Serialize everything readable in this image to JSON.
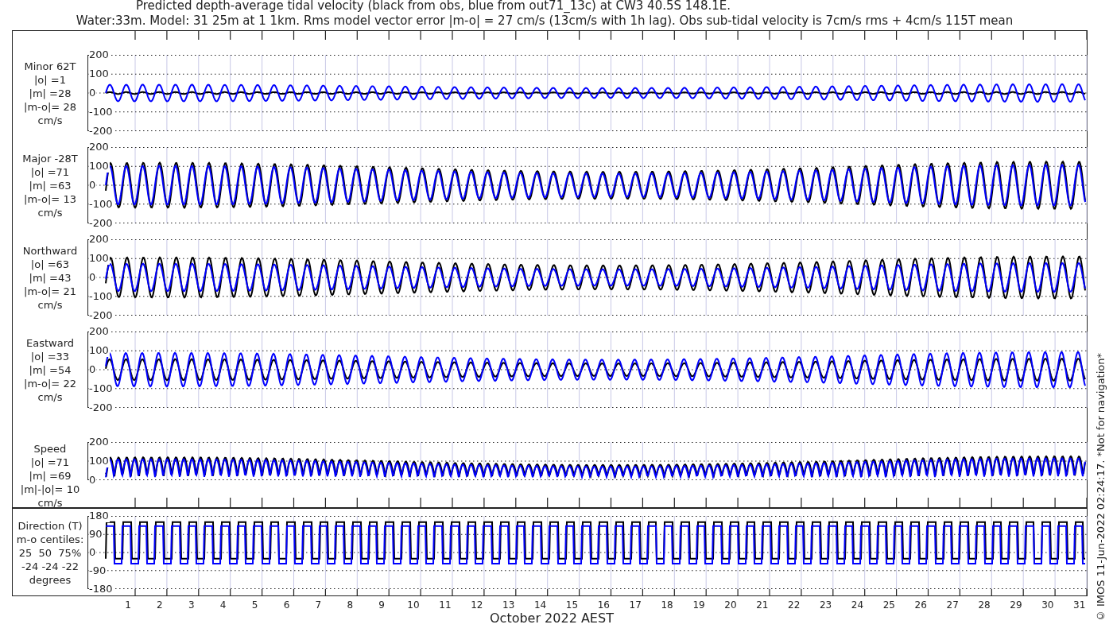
{
  "title_lines": [
    "Predicted depth-average tidal velocity (black from obs, blue from out71_13c) at CW3 40.5S 148.1E.",
    "Water:33m. Model: 31 25m at 1 1km. Rms model vector error |m-o| = 27 cm/s (13cm/s with 1h lag). Obs sub-tidal velocity is 7cm/s rms + 4cm/s 115T mean"
  ],
  "panels": [
    {
      "kind": "velocity",
      "label_lines": [
        "Minor 62T",
        "|o| =1",
        "|m| =28",
        "|m-o|= 28",
        "cm/s"
      ],
      "yticks": [
        "200",
        "100",
        "0",
        "-100",
        "-200"
      ]
    },
    {
      "kind": "velocity",
      "label_lines": [
        "Major -28T",
        "|o| =71",
        "|m| =63",
        "|m-o|= 13",
        "cm/s"
      ],
      "yticks": [
        "200",
        "100",
        "0",
        "-100",
        "-200"
      ]
    },
    {
      "kind": "velocity",
      "label_lines": [
        "Northward",
        "|o| =63",
        "|m| =43",
        "|m-o|= 21",
        "cm/s"
      ],
      "yticks": [
        "200",
        "100",
        "0",
        "-100",
        "-200"
      ]
    },
    {
      "kind": "velocity",
      "label_lines": [
        "Eastward",
        "|o| =33",
        "|m| =54",
        "|m-o|= 22",
        "cm/s"
      ],
      "yticks": [
        "200",
        "100",
        "0",
        "-100",
        "-200"
      ]
    },
    {
      "kind": "speed",
      "label_lines": [
        "Speed",
        "|o| =71",
        "|m| =69",
        "|m|-|o|= 10",
        "cm/s"
      ],
      "yticks": [
        "200",
        "100",
        "0"
      ]
    },
    {
      "kind": "direction",
      "label_lines": [
        "Direction (T)",
        "m-o centiles:",
        "25  50  75%",
        "-24 -24 -22",
        "degrees"
      ],
      "yticks": [
        "180",
        "90",
        "0",
        "-90",
        "-180"
      ]
    }
  ],
  "x_axis": {
    "day_labels": [
      "1",
      "2",
      "3",
      "4",
      "5",
      "6",
      "7",
      "8",
      "9",
      "10",
      "11",
      "12",
      "13",
      "14",
      "15",
      "16",
      "17",
      "18",
      "19",
      "20",
      "21",
      "22",
      "23",
      "24",
      "25",
      "26",
      "27",
      "28",
      "29",
      "30",
      "31"
    ],
    "label": "October 2022 AEST"
  },
  "footer_note": "© IMOS 11-Jun-2022 02:24:17. *Not for navigation*"
}
